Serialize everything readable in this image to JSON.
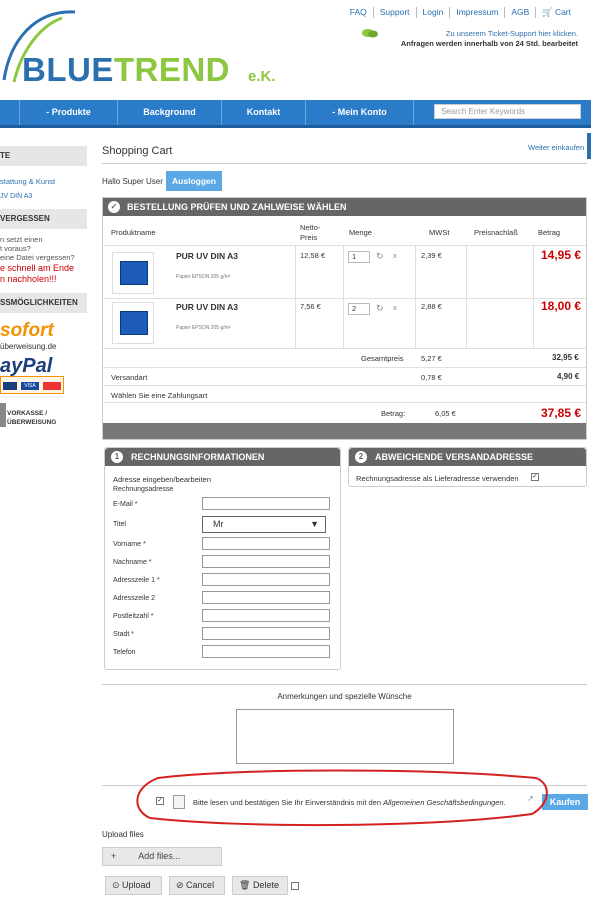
{
  "toplinks": [
    "FAQ",
    "Support",
    "Login",
    "Impressum",
    "AGB",
    "Cart"
  ],
  "ticket": {
    "line1": "Zu unserem Ticket-Support hier klicken.",
    "line2": "Anfragen werden innerhalb von 24 Std. bearbeitet"
  },
  "logo": {
    "a": "BLUE",
    "b": "TREND",
    "ek": "e.K."
  },
  "nav": {
    "produkte": "- Produkte",
    "background": "Background",
    "kontakt": "Kontakt",
    "konto": "- Mein Konto",
    "search_placeholder": "Search Enter Keywords"
  },
  "sidebar": {
    "h1": "TE",
    "t1": "stattung & Kunst",
    "t2": "JV DIN A3",
    "h2": "VERGESSEN",
    "t3": "n setzt einen",
    "t4": "t voraus?",
    "t5": "eine Datei vergessen?",
    "t6": "e schnell am Ende",
    "t7": "n nachholen!!!",
    "h3": "SSMÖGLICHKEITEN",
    "sofort1": "sofort",
    "sofort2": "überweisung.de",
    "paypal": "ayPal",
    "vorkasse1": "VORKASSE /",
    "vorkasse2": "ÜBERWEISUNG"
  },
  "page": {
    "title": "Shopping Cart",
    "weiter": "Weiter einkaufen",
    "hallo": "Hallo Super User",
    "ausloggen": "Ausloggen"
  },
  "cart": {
    "head": "BESTELLUNG PRÜFEN UND ZAHLWEISE WÄHLEN",
    "cols": {
      "name": "Produktname",
      "netto1": "Netto-",
      "netto2": "Preis",
      "menge": "Menge",
      "mwst": "MWSt",
      "nachlass": "Preisnachlaß",
      "betrag": "Betrag"
    },
    "items": [
      {
        "name": "PUR UV DIN A3",
        "desc": "Papier EPSON 205 g/m²",
        "price": "12,58 €",
        "qty": "1",
        "mwst": "2,39 €",
        "betrag": "14,95 €"
      },
      {
        "name": "PUR UV DIN A3",
        "desc": "Papier EPSON 205 g/m²",
        "price": "7,56 €",
        "qty": "2",
        "mwst": "2,88 €",
        "betrag": "18,00 €"
      }
    ],
    "gesamt_label": "Gesamtpreis",
    "gesamt_mwst": "5,27 €",
    "gesamt": "32,95 €",
    "versand_label": "Versandart",
    "versand_mwst": "0,78 €",
    "versand": "4,90 €",
    "zahlung": "Wählen Sie eine Zahlungsart",
    "betrag_label": "Betrag:",
    "betrag_mwst": "6,05 €",
    "betrag": "37,85 €"
  },
  "rechnung": {
    "num": "1",
    "head": "RECHNUNGSINFORMATIONEN",
    "edit": "Adresse eingeben/bearbeiten",
    "sub": "Rechnungsadresse",
    "email": "E-Mail *",
    "titel": "Titel",
    "titel_value": "Mr",
    "vorname": "Vorname *",
    "nachname": "Nachname *",
    "adr1": "Adresszeile 1 *",
    "adr2": "Adresszeile 2",
    "plz": "Postleitzahl *",
    "stadt": "Stadt *",
    "telefon": "Telefon"
  },
  "versand": {
    "num": "2",
    "head": "ABWEICHENDE VERSANDADRESSE",
    "text": "Rechnungsadresse als Lieferadresse verwenden"
  },
  "anmerkungen": "Anmerkungen und spezielle Wünsche",
  "agb": {
    "text": "Bitte lesen und bestätigen Sie Ihr Einverständnis mit den ",
    "link": "Allgemeinen Geschäftsbedingungen",
    "end": "."
  },
  "kaufen": "Kaufen",
  "upload": {
    "title": "Upload files",
    "add": "Add files...",
    "upload": "Upload",
    "cancel": "Cancel",
    "delete": "Delete"
  }
}
